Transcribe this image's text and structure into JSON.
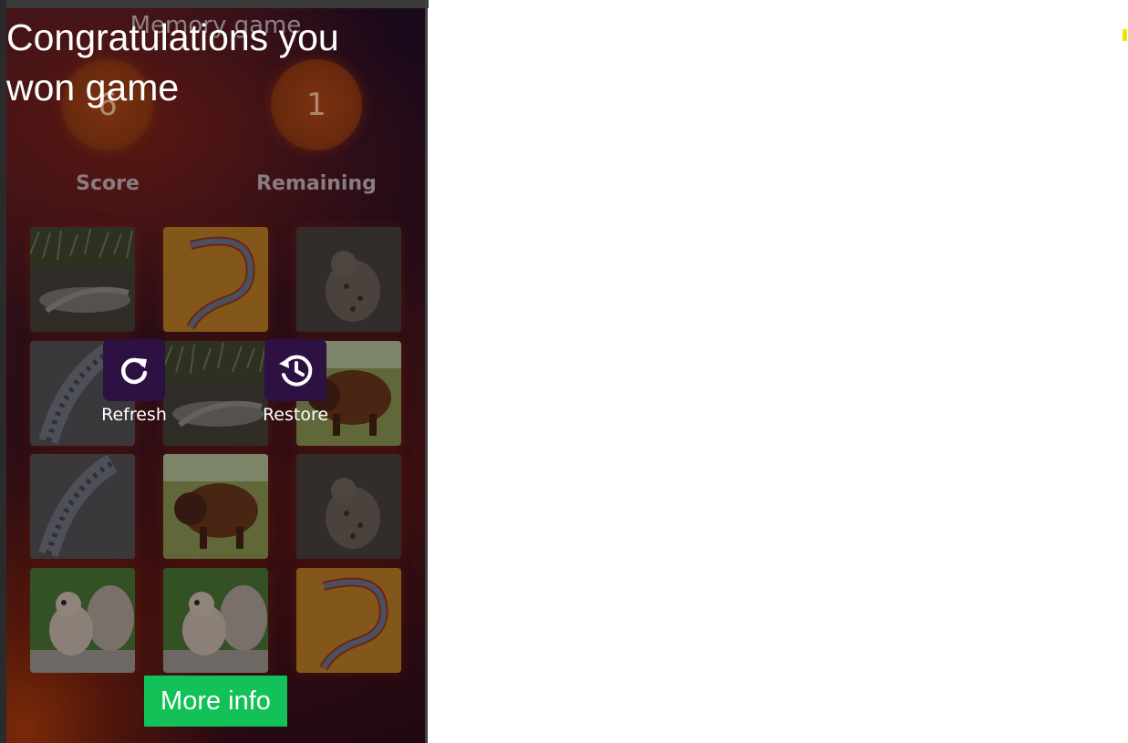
{
  "game": {
    "title": "Memory game",
    "stats": [
      {
        "value": "6",
        "label": "Score"
      },
      {
        "value": "1",
        "label": "Remaining"
      }
    ],
    "cards": [
      {
        "animal": "crocodile",
        "dimmed": true
      },
      {
        "animal": "salamander",
        "dimmed": false
      },
      {
        "animal": "hyena",
        "dimmed": true
      },
      {
        "animal": "iguana",
        "dimmed": true
      },
      {
        "animal": "crocodile",
        "dimmed": true
      },
      {
        "animal": "bison",
        "dimmed": false
      },
      {
        "animal": "iguana",
        "dimmed": true
      },
      {
        "animal": "bison",
        "dimmed": false
      },
      {
        "animal": "hyena",
        "dimmed": true
      },
      {
        "animal": "squirrel",
        "dimmed": false
      },
      {
        "animal": "squirrel",
        "dimmed": false
      },
      {
        "animal": "salamander",
        "dimmed": false
      }
    ]
  },
  "controls": {
    "refresh_label": "Refresh",
    "restore_label": "Restore",
    "refresh_icon": "refresh-icon",
    "restore_icon": "history-icon"
  },
  "overlay": {
    "win_message": "Congratulations you won game",
    "more_info_label": "More info",
    "more_info_color": "#12c157"
  }
}
